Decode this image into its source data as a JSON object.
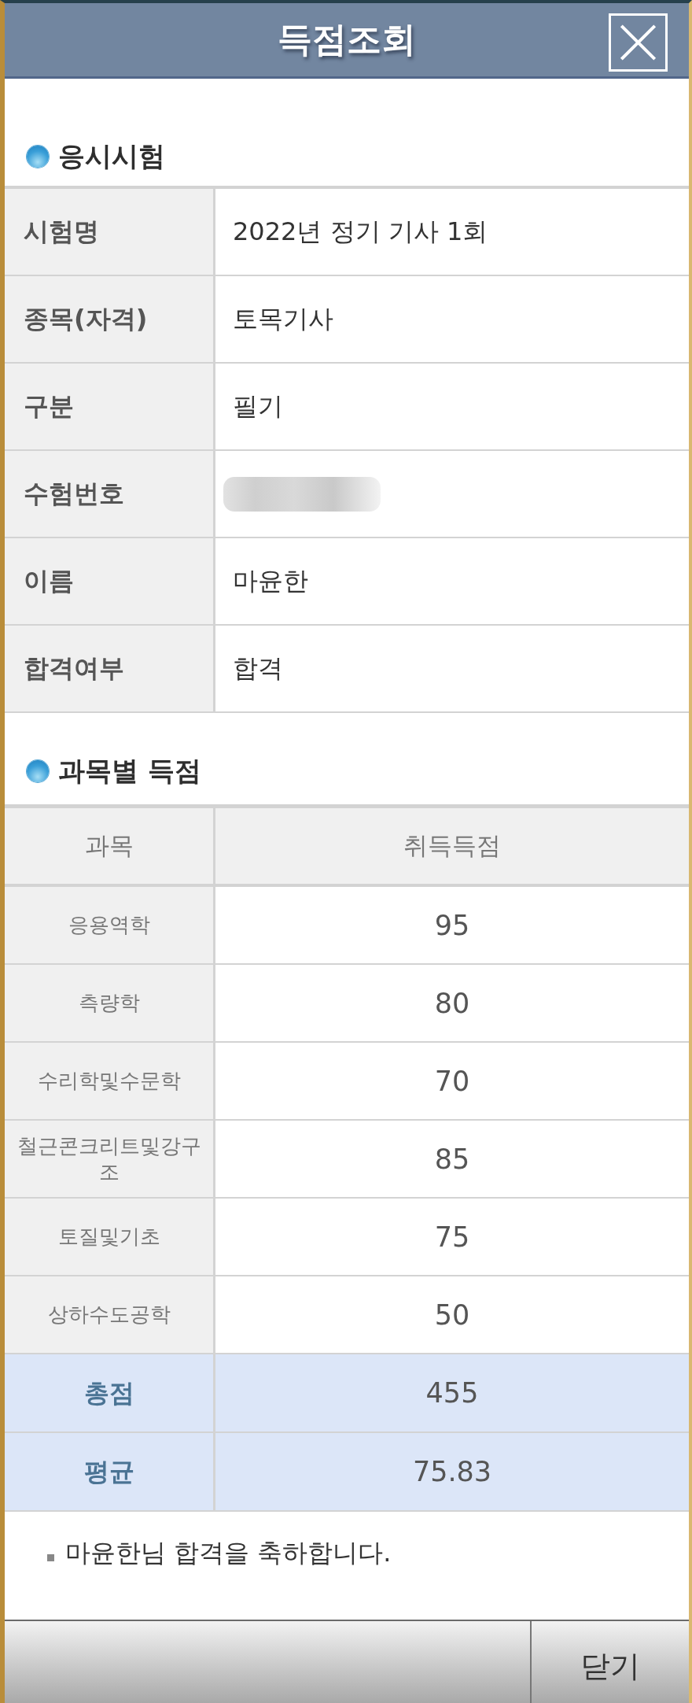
{
  "dialog": {
    "title": "득점조회"
  },
  "exam_section": {
    "heading": "응시시험",
    "rows": [
      {
        "kind": "text",
        "label": "시험명",
        "value": "2022년 정기 기사 1회"
      },
      {
        "kind": "text",
        "label": "종목(자격)",
        "value": "토목기사"
      },
      {
        "kind": "text",
        "label": "구분",
        "value": "필기"
      },
      {
        "kind": "redacted",
        "label": "수험번호"
      },
      {
        "kind": "text",
        "label": "이름",
        "value": "마윤한"
      },
      {
        "kind": "text",
        "label": "합격여부",
        "value": "합격"
      }
    ]
  },
  "score_section": {
    "heading": "과목별 득점",
    "columns": [
      "과목",
      "취득득점"
    ],
    "rows": [
      {
        "kind": "subject",
        "subject": "응용역학",
        "score": "95"
      },
      {
        "kind": "subject",
        "subject": "측량학",
        "score": "80"
      },
      {
        "kind": "subject",
        "subject": "수리학및수문학",
        "score": "70"
      },
      {
        "kind": "subject",
        "subject": "철근콘크리트및강구조",
        "score": "85"
      },
      {
        "kind": "subject",
        "subject": "토질및기초",
        "score": "75"
      },
      {
        "kind": "subject",
        "subject": "상하수도공학",
        "score": "50"
      },
      {
        "kind": "summary",
        "subject": "총점",
        "score": "455"
      },
      {
        "kind": "summary",
        "subject": "평균",
        "score": "75.83"
      }
    ]
  },
  "note": "마윤한님 합격을 축하합니다.",
  "footer": {
    "button": "닫기"
  }
}
